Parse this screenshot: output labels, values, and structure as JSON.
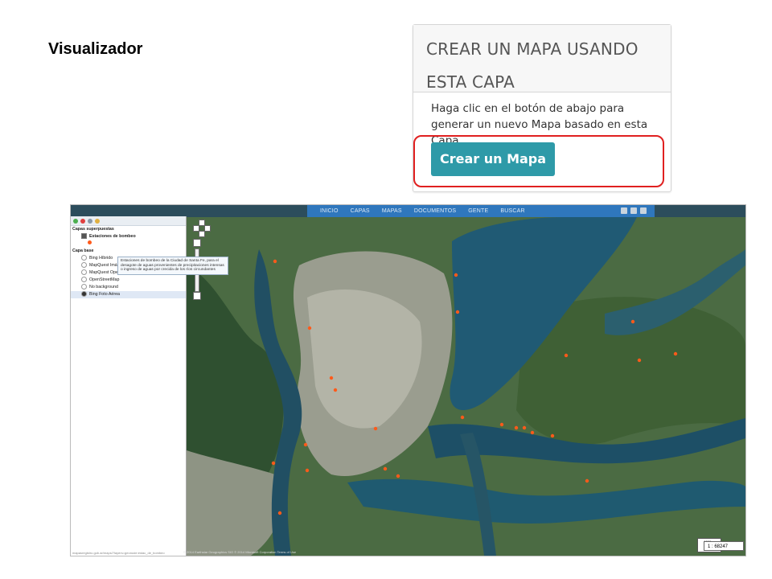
{
  "page": {
    "title": "Visualizador"
  },
  "panel": {
    "title": "CREAR UN MAPA USANDO ESTA CAPA",
    "body": "Haga clic en el botón de abajo para generar un nuevo Mapa basado en esta Capa.",
    "button_label": "Crear un Mapa",
    "accent_color": "#2e9aa8",
    "highlight_color": "#e02020"
  },
  "viewer": {
    "nav": [
      "INICIO",
      "CAPAS",
      "MAPAS",
      "DOCUMENTOS",
      "GENTE",
      "BUSCAR"
    ],
    "social_icons": [
      "facebook-icon",
      "twitter-icon",
      "google-plus-icon"
    ],
    "sidebar": {
      "overlay_section": "Capas superpuestas",
      "overlay_layers": [
        {
          "label": "Estaciones de bombeo",
          "checked": true
        }
      ],
      "base_section": "Capa base",
      "base_layers": [
        {
          "label": "Bing Híbrido",
          "selected": false
        },
        {
          "label": "MapQuest Imágenes",
          "selected": false
        },
        {
          "label": "MapQuest OpenStreetMap",
          "selected": false
        },
        {
          "label": "OpenStreetMap",
          "selected": false
        },
        {
          "label": "No background",
          "selected": false
        },
        {
          "label": "Bing Foto Aérea",
          "selected": true
        }
      ],
      "tooltip": "Estaciones de bombeo de la Ciudad de Santa Fe, para el desagote de aguas provenientes de precipitaciones intensas o ingreso de aguas por crecida de los ríos circundantes",
      "status_url": "mapasregistro.gob.ar/maps/?layers=geonode:estac_de_bombeo"
    },
    "map": {
      "scale_top": "1000 m",
      "scale_bottom": "2000 ft",
      "scale_ratio": "1 : 68247",
      "attribution": "© 2014 Earthstar Geographics SIO © 2014 Microsoft Corporation  Terms of Use"
    }
  }
}
